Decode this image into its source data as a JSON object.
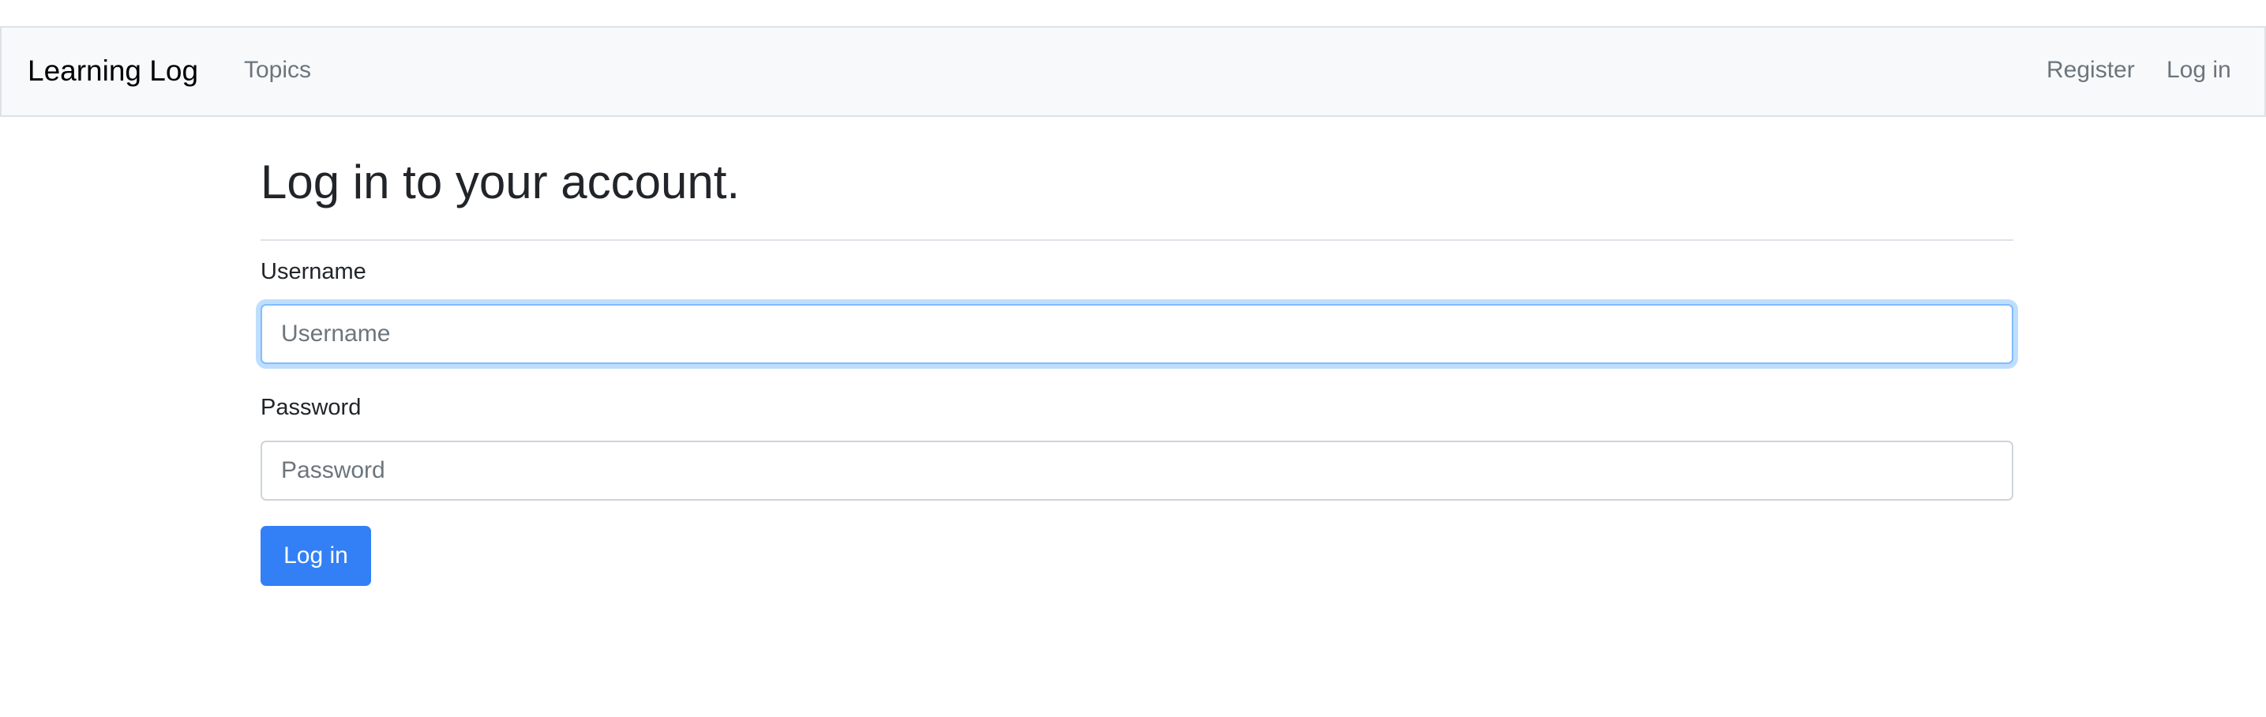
{
  "navbar": {
    "brand": "Learning Log",
    "links": [
      {
        "label": "Topics"
      }
    ],
    "right_links": [
      {
        "label": "Register"
      },
      {
        "label": "Log in"
      }
    ]
  },
  "main": {
    "title": "Log in to your account.",
    "form": {
      "username": {
        "label": "Username",
        "value": "",
        "placeholder": "Username",
        "focused": true
      },
      "password": {
        "label": "Password",
        "value": "",
        "placeholder": "Password"
      },
      "submit_label": "Log in"
    }
  },
  "colors": {
    "primary": "#3380f6",
    "navbar_bg": "#f8f9fa",
    "focus_ring": "#80bdff"
  }
}
